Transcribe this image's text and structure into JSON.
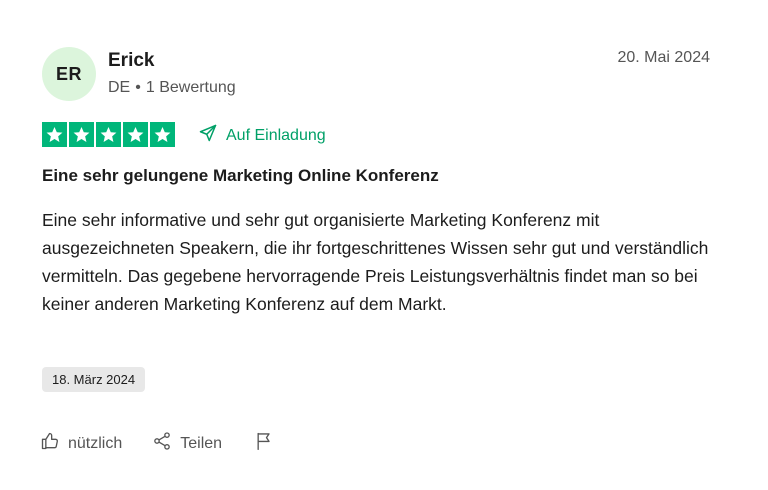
{
  "reviewer": {
    "initials": "ER",
    "name": "Erick",
    "country": "DE",
    "separator": "•",
    "review_count": "1 Bewertung"
  },
  "review": {
    "date": "20. Mai 2024",
    "rating": 5,
    "rating_color": "#00b67a",
    "invited_label": "Auf Einladung",
    "title": "Eine sehr gelungene Marketing Online Konferenz",
    "body": "Eine sehr informative und sehr gut organisierte Marketing Konferenz mit ausgezeichneten Speakern, die ihr fortgeschrittenes Wissen sehr gut und verständlich vermitteln. Das gegebene hervorragende Preis Leistungsverhältnis findet man so bei keiner anderen Marketing Konferenz auf dem Markt.",
    "experience_date": "18. März 2024"
  },
  "actions": {
    "helpful_label": "nützlich",
    "share_label": "Teilen",
    "helpful_icon": "thumbs-up-icon",
    "share_icon": "share-icon",
    "report_icon": "flag-icon"
  },
  "colors": {
    "accent_green": "#00b67a",
    "invite_green": "#00a067",
    "avatar_bg": "#dcf5dc"
  }
}
